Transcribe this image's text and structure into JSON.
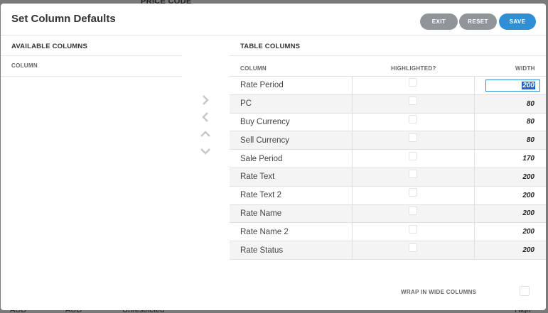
{
  "background": {
    "top_label": "PRICE CODE",
    "bottom_cells": [
      "AUD",
      "AUD",
      "Unrestricted",
      "High Seas"
    ]
  },
  "modal": {
    "title": "Set Column Defaults",
    "buttons": {
      "exit": "EXIT",
      "reset": "RESET",
      "save": "SAVE"
    }
  },
  "available": {
    "title": "AVAILABLE COLUMNS",
    "column_header": "COLUMN"
  },
  "table": {
    "title": "TABLE COLUMNS",
    "headers": {
      "column": "COLUMN",
      "highlighted": "HIGHLIGHTED?",
      "width": "WIDTH"
    },
    "rows": [
      {
        "name": "Rate Period",
        "highlighted": false,
        "width": "200"
      },
      {
        "name": "PC",
        "highlighted": false,
        "width": "80"
      },
      {
        "name": "Buy Currency",
        "highlighted": false,
        "width": "80"
      },
      {
        "name": "Sell Currency",
        "highlighted": false,
        "width": "80"
      },
      {
        "name": "Sale Period",
        "highlighted": false,
        "width": "170"
      },
      {
        "name": "Rate Text",
        "highlighted": false,
        "width": "200"
      },
      {
        "name": "Rate Text 2",
        "highlighted": false,
        "width": "200"
      },
      {
        "name": "Rate Name",
        "highlighted": false,
        "width": "200"
      },
      {
        "name": "Rate Name 2",
        "highlighted": false,
        "width": "200"
      },
      {
        "name": "Rate Status",
        "highlighted": false,
        "width": "200"
      }
    ]
  },
  "arrows": [
    "chevron-right-icon",
    "chevron-left-icon",
    "chevron-up-icon",
    "chevron-down-icon"
  ],
  "wrap": {
    "label": "WRAP IN WIDE COLUMNS",
    "checked": false
  },
  "colors": {
    "accent": "#2e8fd6",
    "secondary_button": "#8f9599"
  }
}
